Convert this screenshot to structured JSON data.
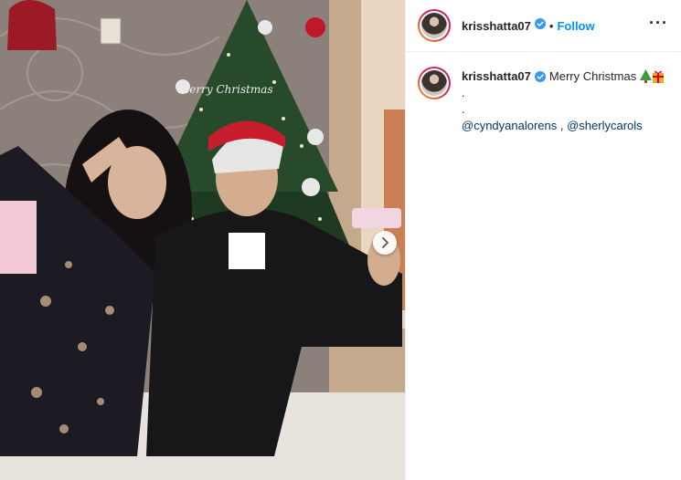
{
  "header": {
    "username": "krisshatta07",
    "separator": "•",
    "follow_label": "Follow",
    "more_label": "···"
  },
  "caption": {
    "username": "krisshatta07",
    "text": "Merry Christmas",
    "emoji": [
      "christmas-tree",
      "wrapped-gift"
    ],
    "dot_line_1": ".",
    "dot_line_2": ".",
    "mention_1": "@cyndyanalorens",
    "mention_sep": " , ",
    "mention_2": "@sherlycarols"
  },
  "photo": {
    "tree_label": "Merry Christmas"
  },
  "colors": {
    "follow": "#0095f6",
    "mention": "#00376b",
    "verified": "#3897f0"
  }
}
